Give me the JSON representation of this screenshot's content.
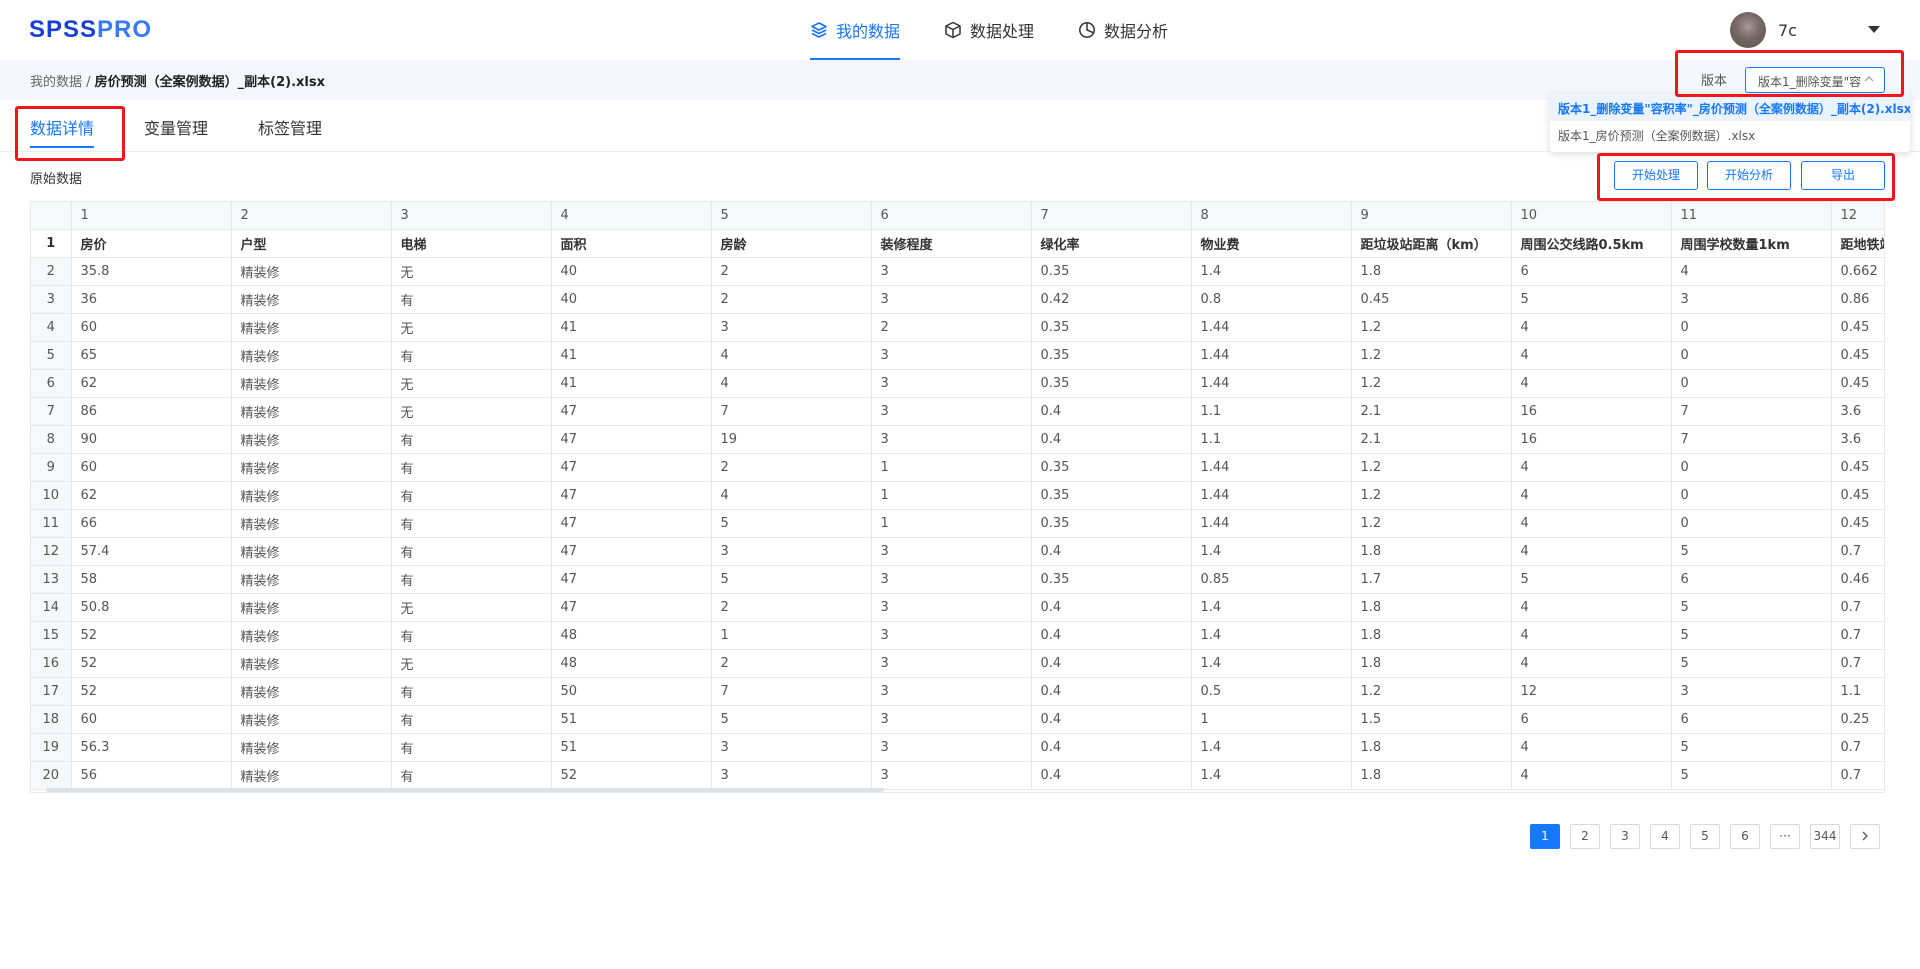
{
  "logo": {
    "part1": "SPSS",
    "part2": "PRO"
  },
  "nav": [
    {
      "label": "我的数据",
      "icon": "layers-icon"
    },
    {
      "label": "数据处理",
      "icon": "cube-icon"
    },
    {
      "label": "数据分析",
      "icon": "pie-chart-icon"
    }
  ],
  "user": {
    "name": "7c"
  },
  "breadcrumb": {
    "root": "我的数据",
    "separator": " / ",
    "current": "房价预测（全案例数据）_副本(2).xlsx"
  },
  "version": {
    "label": "版本",
    "selected": "版本1_删除变量\"容",
    "options": [
      "版本1_删除变量\"容积率\"_房价预测（全案例数据）_副本(2).xlsx",
      "版本1_房价预测（全案例数据）.xlsx"
    ]
  },
  "tabs": [
    "数据详情",
    "变量管理",
    "标签管理"
  ],
  "section_title": "原始数据",
  "buttons": {
    "process": "开始处理",
    "analyze": "开始分析",
    "export": "导出"
  },
  "table": {
    "col_numbers": [
      "1",
      "2",
      "3",
      "4",
      "5",
      "6",
      "7",
      "8",
      "9",
      "10",
      "11",
      "12"
    ],
    "headers": [
      "房价",
      "户型",
      "电梯",
      "面积",
      "房龄",
      "装修程度",
      "绿化率",
      "物业费",
      "距垃圾站距离（km）",
      "周围公交线路0.5km",
      "周围学校数量1km",
      "距地铁站"
    ],
    "rows": [
      [
        "2",
        "35.8",
        "精装修",
        "无",
        "40",
        "2",
        "3",
        "0.35",
        "1.4",
        "1.8",
        "6",
        "4",
        "0.662"
      ],
      [
        "3",
        "36",
        "精装修",
        "有",
        "40",
        "2",
        "3",
        "0.42",
        "0.8",
        "0.45",
        "5",
        "3",
        "0.86"
      ],
      [
        "4",
        "60",
        "精装修",
        "无",
        "41",
        "3",
        "2",
        "0.35",
        "1.44",
        "1.2",
        "4",
        "0",
        "0.45"
      ],
      [
        "5",
        "65",
        "精装修",
        "有",
        "41",
        "4",
        "3",
        "0.35",
        "1.44",
        "1.2",
        "4",
        "0",
        "0.45"
      ],
      [
        "6",
        "62",
        "精装修",
        "无",
        "41",
        "4",
        "3",
        "0.35",
        "1.44",
        "1.2",
        "4",
        "0",
        "0.45"
      ],
      [
        "7",
        "86",
        "精装修",
        "无",
        "47",
        "7",
        "3",
        "0.4",
        "1.1",
        "2.1",
        "16",
        "7",
        "3.6"
      ],
      [
        "8",
        "90",
        "精装修",
        "有",
        "47",
        "19",
        "3",
        "0.4",
        "1.1",
        "2.1",
        "16",
        "7",
        "3.6"
      ],
      [
        "9",
        "60",
        "精装修",
        "有",
        "47",
        "2",
        "1",
        "0.35",
        "1.44",
        "1.2",
        "4",
        "0",
        "0.45"
      ],
      [
        "10",
        "62",
        "精装修",
        "有",
        "47",
        "4",
        "1",
        "0.35",
        "1.44",
        "1.2",
        "4",
        "0",
        "0.45"
      ],
      [
        "11",
        "66",
        "精装修",
        "有",
        "47",
        "5",
        "1",
        "0.35",
        "1.44",
        "1.2",
        "4",
        "0",
        "0.45"
      ],
      [
        "12",
        "57.4",
        "精装修",
        "有",
        "47",
        "3",
        "3",
        "0.4",
        "1.4",
        "1.8",
        "4",
        "5",
        "0.7"
      ],
      [
        "13",
        "58",
        "精装修",
        "有",
        "47",
        "5",
        "3",
        "0.35",
        "0.85",
        "1.7",
        "5",
        "6",
        "0.46"
      ],
      [
        "14",
        "50.8",
        "精装修",
        "无",
        "47",
        "2",
        "3",
        "0.4",
        "1.4",
        "1.8",
        "4",
        "5",
        "0.7"
      ],
      [
        "15",
        "52",
        "精装修",
        "有",
        "48",
        "1",
        "3",
        "0.4",
        "1.4",
        "1.8",
        "4",
        "5",
        "0.7"
      ],
      [
        "16",
        "52",
        "精装修",
        "无",
        "48",
        "2",
        "3",
        "0.4",
        "1.4",
        "1.8",
        "4",
        "5",
        "0.7"
      ],
      [
        "17",
        "52",
        "精装修",
        "有",
        "50",
        "7",
        "3",
        "0.4",
        "0.5",
        "1.2",
        "12",
        "3",
        "1.1"
      ],
      [
        "18",
        "60",
        "精装修",
        "有",
        "51",
        "5",
        "3",
        "0.4",
        "1",
        "1.5",
        "6",
        "6",
        "0.25"
      ],
      [
        "19",
        "56.3",
        "精装修",
        "有",
        "51",
        "3",
        "3",
        "0.4",
        "1.4",
        "1.8",
        "4",
        "5",
        "0.7"
      ],
      [
        "20",
        "56",
        "精装修",
        "有",
        "52",
        "3",
        "3",
        "0.4",
        "1.4",
        "1.8",
        "4",
        "5",
        "0.7"
      ]
    ]
  },
  "pagination": {
    "pages": [
      "1",
      "2",
      "3",
      "4",
      "5",
      "6"
    ],
    "ellipsis": "···",
    "last": "344",
    "current": "1"
  },
  "colors": {
    "accent": "#1677ff",
    "highlight": "#f5141b",
    "brand": "#1a3fd6"
  }
}
